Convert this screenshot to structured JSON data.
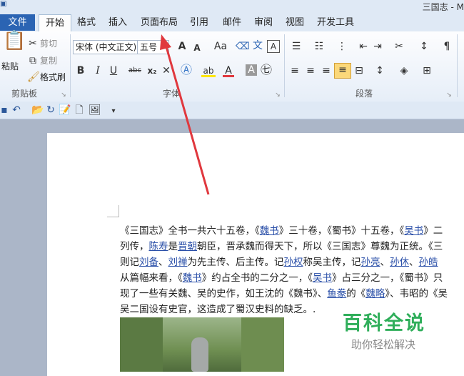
{
  "window": {
    "title": "三国志 - M"
  },
  "tabs": {
    "file": "文件",
    "items": [
      "开始",
      "格式",
      "插入",
      "页面布局",
      "引用",
      "邮件",
      "审阅",
      "视图",
      "开发工具"
    ]
  },
  "clipboard": {
    "paste": "粘贴",
    "cut": "剪切",
    "copy": "复制",
    "format_painter": "格式刷",
    "group_label": "剪贴板"
  },
  "font": {
    "family": "宋体 (中文正文)",
    "size": "五号",
    "group_label": "字体",
    "bold": "B",
    "italic": "I",
    "underline": "U",
    "strike": "abc",
    "subscript": "x₂",
    "superscript": "x²",
    "change_case": "Aa",
    "grow": "A",
    "shrink": "A",
    "clear": "A",
    "highlight": "ab",
    "color": "A"
  },
  "paragraph": {
    "group_label": "段落"
  },
  "document": {
    "lines": [
      [
        {
          "t": "《三国志》全书一共六十五卷，《"
        },
        {
          "t": "魏书",
          "link": true
        },
        {
          "t": "》三十卷，《蜀书》十五卷，《"
        },
        {
          "t": "吴书",
          "link": true
        },
        {
          "t": "》二"
        }
      ],
      [
        {
          "t": "列传，"
        },
        {
          "t": "陈寿",
          "link": true
        },
        {
          "t": "是"
        },
        {
          "t": "晋朝",
          "link": true
        },
        {
          "t": "朝臣，晋承魏而得天下，所以《三国志》尊魏为正统。《三"
        }
      ],
      [
        {
          "t": "则记"
        },
        {
          "t": "刘备",
          "link": true
        },
        {
          "t": "、"
        },
        {
          "t": "刘禅",
          "link": true
        },
        {
          "t": "为先主传、后主传。记"
        },
        {
          "t": "孙权",
          "link": true
        },
        {
          "t": "称吴主传，记"
        },
        {
          "t": "孙亮",
          "link": true
        },
        {
          "t": "、"
        },
        {
          "t": "孙休",
          "link": true
        },
        {
          "t": "、"
        },
        {
          "t": "孙皓",
          "link": true
        }
      ],
      [
        {
          "t": "从篇幅来看，《"
        },
        {
          "t": "魏书",
          "link": true
        },
        {
          "t": "》约占全书的二分之一，《"
        },
        {
          "t": "吴书",
          "link": true
        },
        {
          "t": "》占三分之一，《蜀书》只"
        }
      ],
      [
        {
          "t": "现了一些有关魏、吴的史作，如王沈的《魏书》、"
        },
        {
          "t": "鱼豢",
          "link": true
        },
        {
          "t": "的《"
        },
        {
          "t": "魏略",
          "link": true
        },
        {
          "t": "》、韦昭的《吴"
        }
      ],
      [
        {
          "t": "吴二国设有史官，这造成了蜀汉史料的缺乏。."
        }
      ]
    ]
  },
  "watermark": {
    "title": "百科全说",
    "subtitle": "助你轻松解决"
  },
  "colors": {
    "file_tab": "#2b64b3",
    "link": "#2a4fa8",
    "arrow": "#e0383e",
    "watermark": "#2fae5a"
  }
}
